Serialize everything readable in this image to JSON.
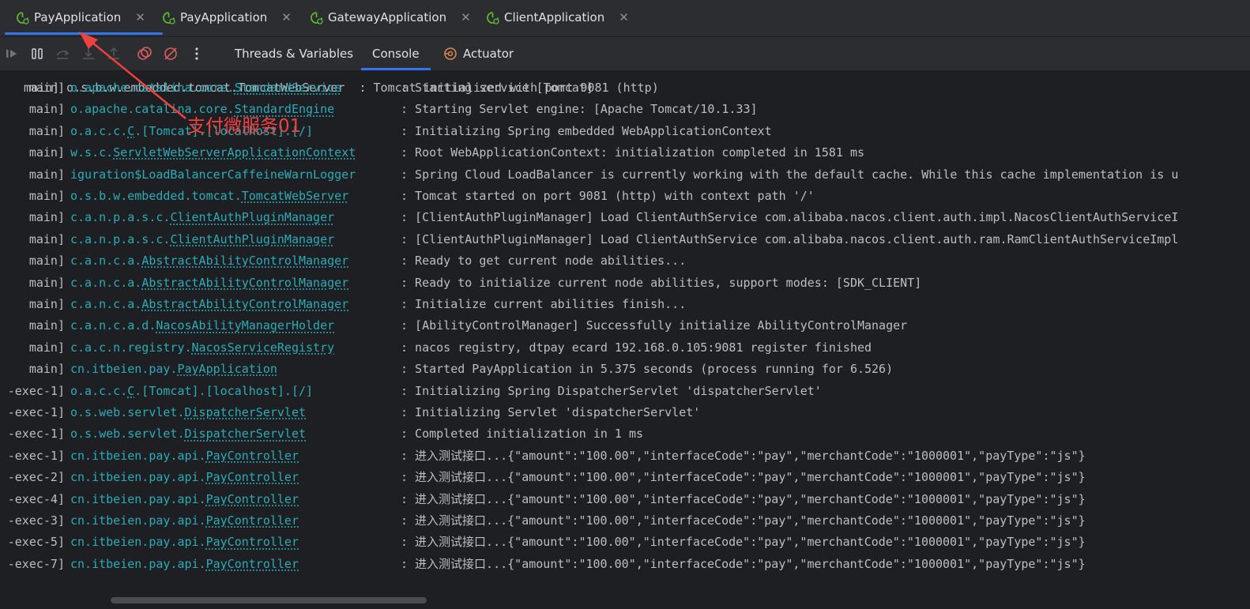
{
  "tabs": [
    {
      "label": "PayApplication",
      "active": true
    },
    {
      "label": "PayApplication",
      "active": false
    },
    {
      "label": "GatewayApplication",
      "active": false
    },
    {
      "label": "ClientApplication",
      "active": false
    }
  ],
  "toolbar": {
    "icons": [
      "resume-icon",
      "pause-icon",
      "step-over-icon",
      "step-into-icon",
      "step-out-icon",
      "view-breakpoints-icon",
      "mute-breakpoints-icon",
      "more-icon"
    ],
    "subtabs": [
      {
        "label": "Threads & Variables",
        "active": false
      },
      {
        "label": "Console",
        "active": true
      },
      {
        "label": "Actuator",
        "active": false
      }
    ]
  },
  "annotation": {
    "text": "支付微服务01",
    "color": "#f04040"
  },
  "console": {
    "partial_top": "main] o.s.b.w.embedded.tomcat.TomcatWebServer  : Tomcat initialized with port 9081 (http)",
    "lines": [
      {
        "thread": "main]",
        "pkg": "o.apache.catalina.core.",
        "cls": "StandardService",
        "pad": "   ",
        "msg": ": Starting service [Tomcat]"
      },
      {
        "thread": "main]",
        "pkg": "o.apache.catalina.core.",
        "cls": "StandardEngine",
        "pad": "    ",
        "msg": ": Starting Servlet engine: [Apache Tomcat/10.1.33]"
      },
      {
        "thread": "main]",
        "pkg": "o.a.c.c.",
        "cls": "C",
        "rest": ".[Tomcat].[localhost].[/]",
        "pad": "     ",
        "msg": ": Initializing Spring embedded WebApplicationContext"
      },
      {
        "thread": "main]",
        "pkg": "w.s.c.",
        "cls": "ServletWebServerApplicationContext",
        "pad": " ",
        "msg": ": Root WebApplicationContext: initialization completed in 1581 ms"
      },
      {
        "thread": "main]",
        "pkg": "iguration$LoadBalancerCaffeineWarnLogger",
        "cls": "",
        "pad": " ",
        "msg": ": Spring Cloud LoadBalancer is currently working with the default cache. While this cache implementation is u"
      },
      {
        "thread": "main]",
        "pkg": "o.s.b.w.embedded.tomcat.",
        "cls": "TomcatWebServer",
        "pad": "  ",
        "msg": ": Tomcat started on port 9081 (http) with context path '/'"
      },
      {
        "thread": "main]",
        "pkg": "c.a.n.p.a.s.c.",
        "cls": "ClientAuthPluginManager",
        "pad": "    ",
        "msg": ": [ClientAuthPluginManager] Load ClientAuthService com.alibaba.nacos.client.auth.impl.NacosClientAuthServiceI"
      },
      {
        "thread": "main]",
        "pkg": "c.a.n.p.a.s.c.",
        "cls": "ClientAuthPluginManager",
        "pad": "    ",
        "msg": ": [ClientAuthPluginManager] Load ClientAuthService com.alibaba.nacos.client.auth.ram.RamClientAuthServiceImpl"
      },
      {
        "thread": "main]",
        "pkg": "c.a.n.c.a.",
        "cls": "AbstractAbilityControlManager",
        "pad": "  ",
        "msg": ": Ready to get current node abilities..."
      },
      {
        "thread": "main]",
        "pkg": "c.a.n.c.a.",
        "cls": "AbstractAbilityControlManager",
        "pad": "  ",
        "msg": ": Ready to initialize current node abilities, support modes: [SDK_CLIENT]"
      },
      {
        "thread": "main]",
        "pkg": "c.a.n.c.a.",
        "cls": "AbstractAbilityControlManager",
        "pad": "  ",
        "msg": ": Initialize current abilities finish..."
      },
      {
        "thread": "main]",
        "pkg": "c.a.n.c.a.d.",
        "cls": "NacosAbilityManagerHolder",
        "pad": "    ",
        "msg": ": [AbilityControlManager] Successfully initialize AbilityControlManager"
      },
      {
        "thread": "main]",
        "pkg": "c.a.c.n.registry.",
        "cls": "NacosServiceRegistry",
        "pad": "    ",
        "msg": ": nacos registry, dtpay ecard 192.168.0.105:9081 register finished"
      },
      {
        "thread": "main]",
        "pkg": "cn.itbeien.pay.",
        "cls": "PayApplication",
        "pad": "            ",
        "msg": ": Started PayApplication in 5.375 seconds (process running for 6.526)"
      },
      {
        "thread": "-exec-1]",
        "pkg": "o.a.c.c.",
        "cls": "C",
        "rest": ".[Tomcat].[localhost].[/]",
        "pad": "       ",
        "msg": ": Initializing Spring DispatcherServlet 'dispatcherServlet'"
      },
      {
        "thread": "-exec-1]",
        "pkg": "o.s.web.servlet.",
        "cls": "DispatcherServlet",
        "pad": "        ",
        "msg": ": Initializing Servlet 'dispatcherServlet'"
      },
      {
        "thread": "-exec-1]",
        "pkg": "o.s.web.servlet.",
        "cls": "DispatcherServlet",
        "pad": "        ",
        "msg": ": Completed initialization in 1 ms"
      },
      {
        "thread": "-exec-1]",
        "pkg": "cn.itbeien.pay.api.",
        "cls": "PayController",
        "pad": "         ",
        "msg": ": 进入测试接口...{\"amount\":\"100.00\",\"interfaceCode\":\"pay\",\"merchantCode\":\"1000001\",\"payType\":\"js\"}"
      },
      {
        "thread": "-exec-2]",
        "pkg": "cn.itbeien.pay.api.",
        "cls": "PayController",
        "pad": "         ",
        "msg": ": 进入测试接口...{\"amount\":\"100.00\",\"interfaceCode\":\"pay\",\"merchantCode\":\"1000001\",\"payType\":\"js\"}"
      },
      {
        "thread": "-exec-4]",
        "pkg": "cn.itbeien.pay.api.",
        "cls": "PayController",
        "pad": "         ",
        "msg": ": 进入测试接口...{\"amount\":\"100.00\",\"interfaceCode\":\"pay\",\"merchantCode\":\"1000001\",\"payType\":\"js\"}"
      },
      {
        "thread": "-exec-3]",
        "pkg": "cn.itbeien.pay.api.",
        "cls": "PayController",
        "pad": "         ",
        "msg": ": 进入测试接口...{\"amount\":\"100.00\",\"interfaceCode\":\"pay\",\"merchantCode\":\"1000001\",\"payType\":\"js\"}"
      },
      {
        "thread": "-exec-5]",
        "pkg": "cn.itbeien.pay.api.",
        "cls": "PayController",
        "pad": "         ",
        "msg": ": 进入测试接口...{\"amount\":\"100.00\",\"interfaceCode\":\"pay\",\"merchantCode\":\"1000001\",\"payType\":\"js\"}"
      },
      {
        "thread": "-exec-7]",
        "pkg": "cn.itbeien.pay.api.",
        "cls": "PayController",
        "pad": "         ",
        "msg": ": 进入测试接口...{\"amount\":\"100.00\",\"interfaceCode\":\"pay\",\"merchantCode\":\"1000001\",\"payType\":\"js\"}"
      }
    ]
  }
}
